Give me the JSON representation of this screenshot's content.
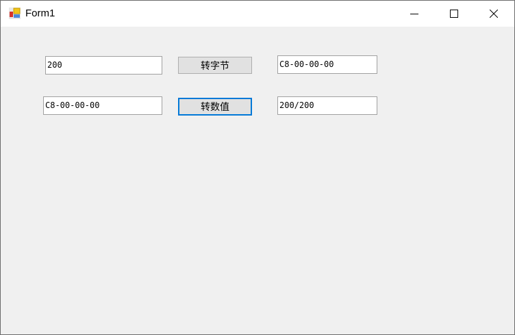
{
  "window": {
    "title": "Form1"
  },
  "controls": {
    "minimize": "minimize-icon",
    "maximize": "maximize-icon",
    "close": "close-icon"
  },
  "row1": {
    "input": "200",
    "button": "转字节",
    "output": "C8-00-00-00"
  },
  "row2": {
    "input": "C8-00-00-00",
    "button": "转数值",
    "output": "200/200"
  },
  "colors": {
    "focus": "#0078d7",
    "background": "#f0f0f0"
  }
}
